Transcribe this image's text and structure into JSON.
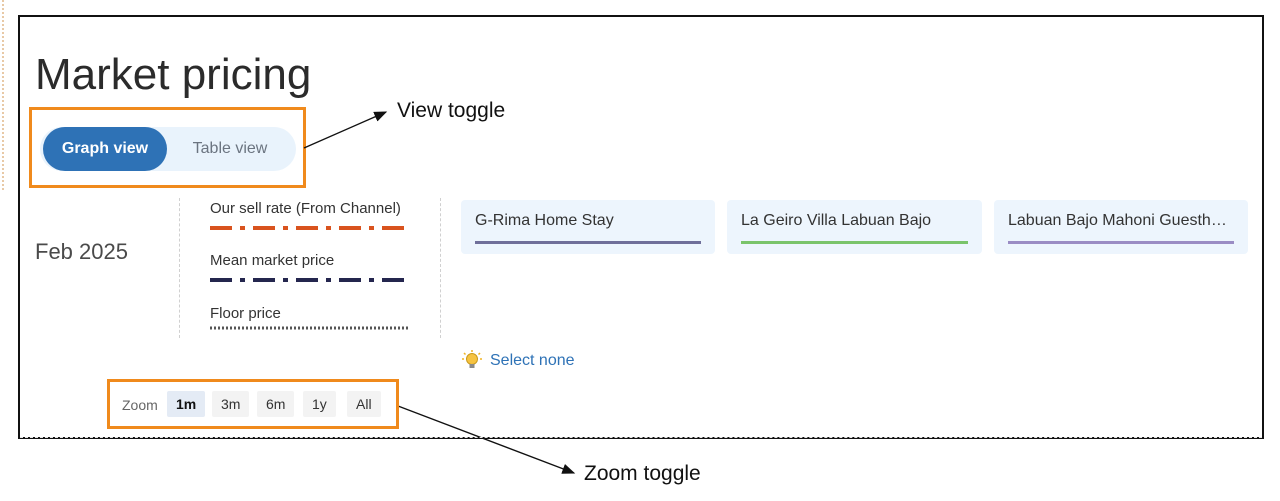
{
  "page": {
    "title": "Market pricing"
  },
  "view_toggle": {
    "graph_label": "Graph view",
    "table_label": "Table view",
    "selected": "Graph view"
  },
  "annotations": {
    "view_toggle": "View toggle",
    "zoom_toggle": "Zoom toggle",
    "highlight_color": "#f08a1c"
  },
  "month_label": "Feb 2025",
  "legend": [
    {
      "label": "Our sell rate (From Channel)",
      "style": "dash-dot",
      "color": "#d9531e"
    },
    {
      "label": "Mean market price",
      "style": "dash-dot",
      "color": "#24264e"
    },
    {
      "label": "Floor price",
      "style": "dotted",
      "color": "#555555"
    }
  ],
  "properties": [
    {
      "name": "G-Rima Home Stay",
      "color": "#6f6f9a"
    },
    {
      "name": "La Geiro Villa Labuan Bajo",
      "color": "#7ac46b"
    },
    {
      "name": "Labuan Bajo Mahoni Guestho…",
      "color": "#9a8cc4"
    }
  ],
  "select_none": {
    "icon": "lightbulb-icon",
    "label": "Select none"
  },
  "zoom": {
    "label": "Zoom",
    "options": [
      "1m",
      "3m",
      "6m",
      "1y",
      "All"
    ],
    "selected": "1m"
  },
  "colors": {
    "accent": "#2e72b6",
    "toggle_bg": "#e9f3fc",
    "card_bg": "#edf5fd"
  }
}
